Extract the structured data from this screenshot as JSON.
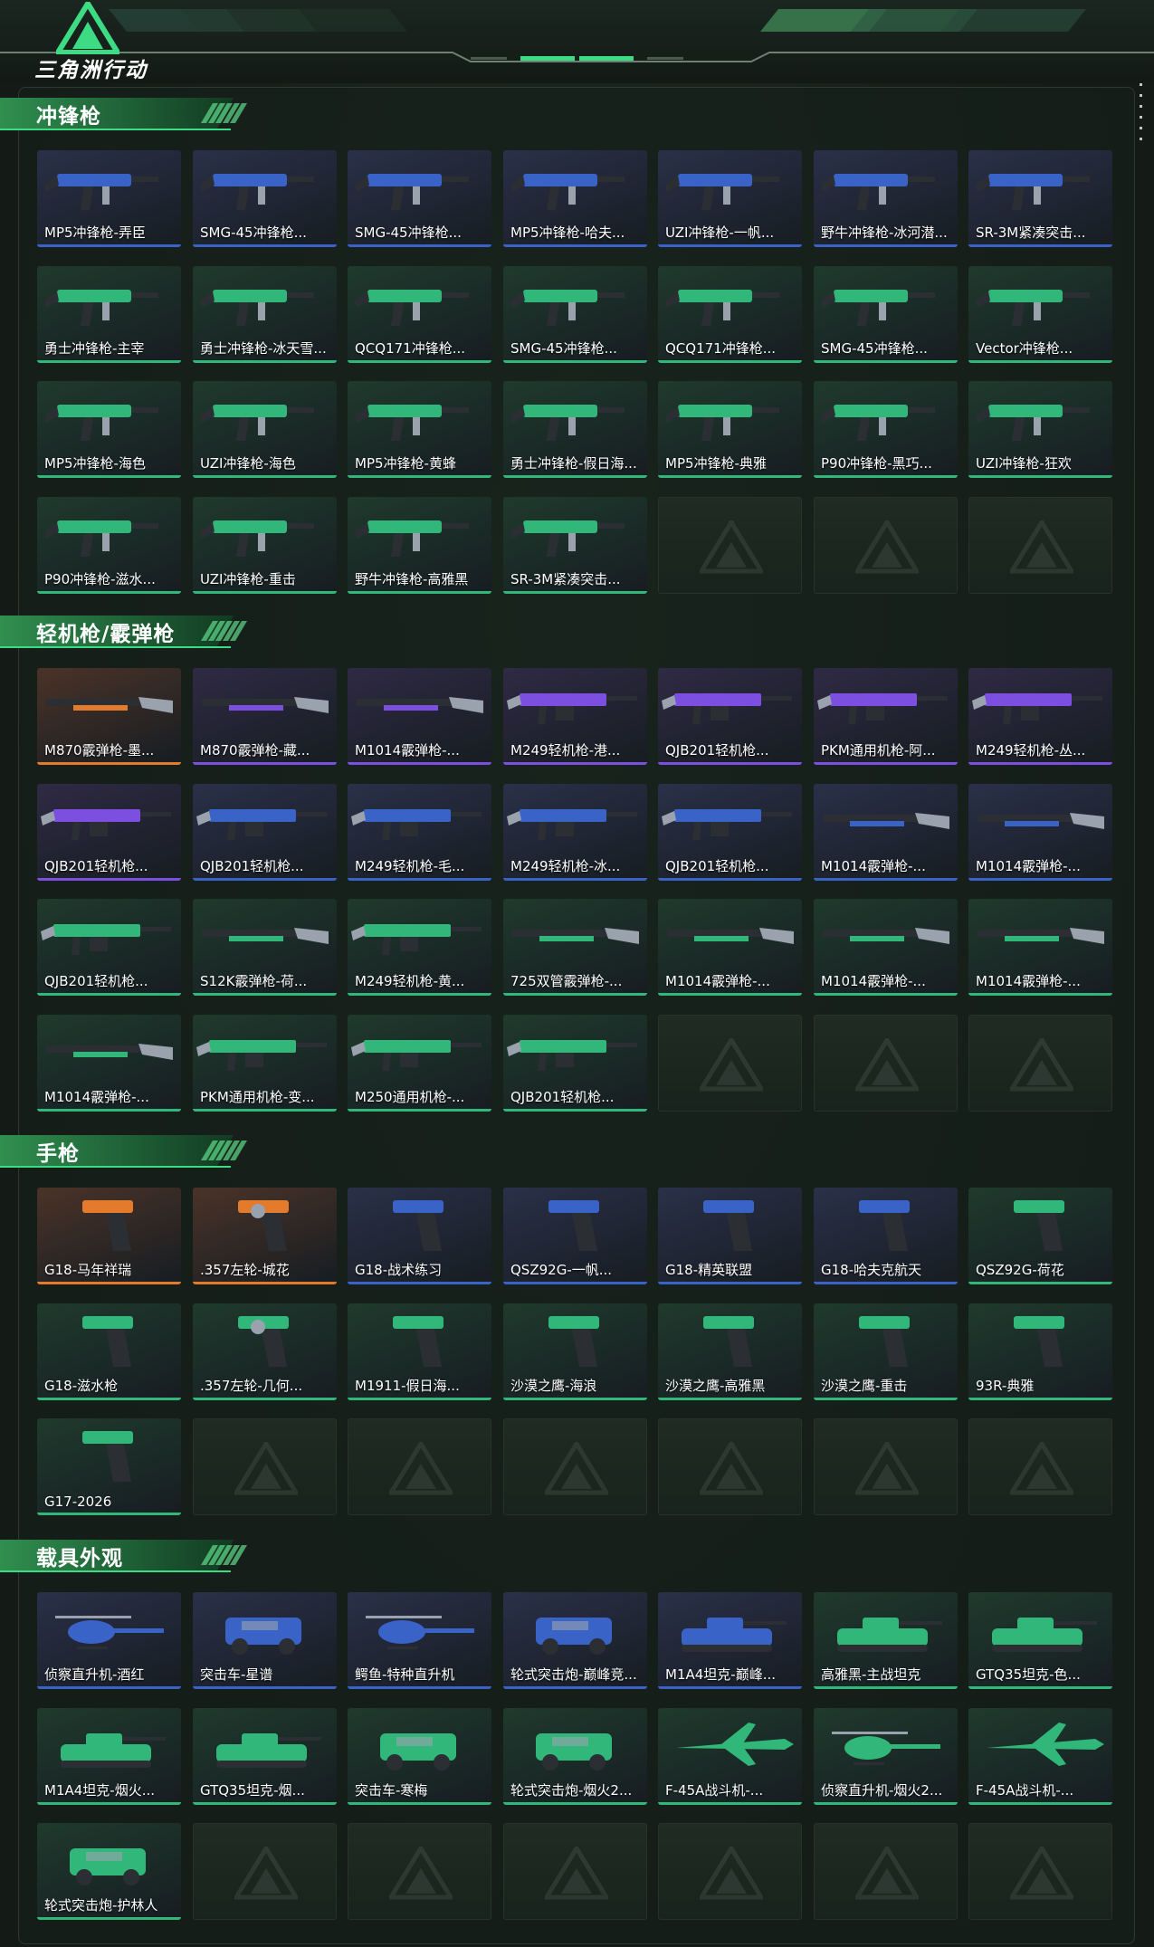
{
  "header": {
    "logo_text": "三角洲行动"
  },
  "colors": {
    "blue": "#3a63c8",
    "purple": "#7d4fe0",
    "orange": "#e37a2c",
    "green": "#31b779",
    "bg_blue": "#2a3048",
    "bg_purple": "#2f2a44",
    "bg_orange": "#4a3328",
    "bg_green": "#1f3a2d"
  },
  "sections": [
    {
      "title": "冲锋枪",
      "items": [
        {
          "label": "MP5冲锋枪-弄臣",
          "rarity": "blue",
          "icon": "smg-icon"
        },
        {
          "label": "SMG-45冲锋枪...",
          "rarity": "blue",
          "icon": "smg-icon"
        },
        {
          "label": "SMG-45冲锋枪...",
          "rarity": "blue",
          "icon": "smg-icon"
        },
        {
          "label": "MP5冲锋枪-哈夫...",
          "rarity": "blue",
          "icon": "smg-icon"
        },
        {
          "label": "UZI冲锋枪-一帆...",
          "rarity": "blue",
          "icon": "smg-icon"
        },
        {
          "label": "野牛冲锋枪-冰河潜...",
          "rarity": "blue",
          "icon": "smg-icon"
        },
        {
          "label": "SR-3M紧凑突击...",
          "rarity": "blue",
          "icon": "smg-icon"
        },
        {
          "label": "勇士冲锋枪-主宰",
          "rarity": "green",
          "icon": "smg-icon"
        },
        {
          "label": "勇士冲锋枪-冰天雪...",
          "rarity": "green",
          "icon": "smg-icon"
        },
        {
          "label": "QCQ171冲锋枪...",
          "rarity": "green",
          "icon": "smg-icon"
        },
        {
          "label": "SMG-45冲锋枪...",
          "rarity": "green",
          "icon": "smg-icon"
        },
        {
          "label": "QCQ171冲锋枪...",
          "rarity": "green",
          "icon": "smg-icon"
        },
        {
          "label": "SMG-45冲锋枪...",
          "rarity": "green",
          "icon": "smg-icon"
        },
        {
          "label": "Vector冲锋枪...",
          "rarity": "green",
          "icon": "smg-icon"
        },
        {
          "label": "MP5冲锋枪-海色",
          "rarity": "green",
          "icon": "smg-icon"
        },
        {
          "label": "UZI冲锋枪-海色",
          "rarity": "green",
          "icon": "smg-icon"
        },
        {
          "label": "MP5冲锋枪-黄蜂",
          "rarity": "green",
          "icon": "smg-icon"
        },
        {
          "label": "勇士冲锋枪-假日海...",
          "rarity": "green",
          "icon": "smg-icon"
        },
        {
          "label": "MP5冲锋枪-典雅",
          "rarity": "green",
          "icon": "smg-icon"
        },
        {
          "label": "P90冲锋枪-黑巧...",
          "rarity": "green",
          "icon": "smg-icon"
        },
        {
          "label": "UZI冲锋枪-狂欢",
          "rarity": "green",
          "icon": "smg-icon"
        },
        {
          "label": "P90冲锋枪-滋水...",
          "rarity": "green",
          "icon": "smg-icon"
        },
        {
          "label": "UZI冲锋枪-重击",
          "rarity": "green",
          "icon": "smg-icon"
        },
        {
          "label": "野牛冲锋枪-高雅黑",
          "rarity": "green",
          "icon": "smg-icon"
        },
        {
          "label": "SR-3M紧凑突击...",
          "rarity": "green",
          "icon": "smg-icon"
        }
      ]
    },
    {
      "title": "轻机枪/霰弹枪",
      "items": [
        {
          "label": "M870霰弹枪-墨...",
          "rarity": "orange",
          "icon": "shotgun-icon"
        },
        {
          "label": "M870霰弹枪-藏...",
          "rarity": "purple",
          "icon": "shotgun-icon"
        },
        {
          "label": "M1014霰弹枪-...",
          "rarity": "purple",
          "icon": "shotgun-icon"
        },
        {
          "label": "M249轻机枪-港...",
          "rarity": "purple",
          "icon": "lmg-icon"
        },
        {
          "label": "QJB201轻机枪...",
          "rarity": "purple",
          "icon": "lmg-icon"
        },
        {
          "label": "PKM通用机枪-阿...",
          "rarity": "purple",
          "icon": "lmg-icon"
        },
        {
          "label": "M249轻机枪-丛...",
          "rarity": "purple",
          "icon": "lmg-icon"
        },
        {
          "label": "QJB201轻机枪...",
          "rarity": "purple",
          "icon": "lmg-icon"
        },
        {
          "label": "QJB201轻机枪...",
          "rarity": "blue",
          "icon": "lmg-icon"
        },
        {
          "label": "M249轻机枪-毛...",
          "rarity": "blue",
          "icon": "lmg-icon"
        },
        {
          "label": "M249轻机枪-冰...",
          "rarity": "blue",
          "icon": "lmg-icon"
        },
        {
          "label": "QJB201轻机枪...",
          "rarity": "blue",
          "icon": "lmg-icon"
        },
        {
          "label": "M1014霰弹枪-...",
          "rarity": "blue",
          "icon": "shotgun-icon"
        },
        {
          "label": "M1014霰弹枪-...",
          "rarity": "blue",
          "icon": "shotgun-icon"
        },
        {
          "label": "QJB201轻机枪...",
          "rarity": "green",
          "icon": "lmg-icon"
        },
        {
          "label": "S12K霰弹枪-荷...",
          "rarity": "green",
          "icon": "shotgun-icon"
        },
        {
          "label": "M249轻机枪-黄...",
          "rarity": "green",
          "icon": "lmg-icon"
        },
        {
          "label": "725双管霰弹枪-...",
          "rarity": "green",
          "icon": "shotgun-icon"
        },
        {
          "label": "M1014霰弹枪-...",
          "rarity": "green",
          "icon": "shotgun-icon"
        },
        {
          "label": "M1014霰弹枪-...",
          "rarity": "green",
          "icon": "shotgun-icon"
        },
        {
          "label": "M1014霰弹枪-...",
          "rarity": "green",
          "icon": "shotgun-icon"
        },
        {
          "label": "M1014霰弹枪-...",
          "rarity": "green",
          "icon": "shotgun-icon"
        },
        {
          "label": "PKM通用机枪-变...",
          "rarity": "green",
          "icon": "lmg-icon"
        },
        {
          "label": "M250通用机枪-...",
          "rarity": "green",
          "icon": "lmg-icon"
        },
        {
          "label": "QJB201轻机枪...",
          "rarity": "green",
          "icon": "lmg-icon"
        }
      ]
    },
    {
      "title": "手枪",
      "items": [
        {
          "label": "G18-马年祥瑞",
          "rarity": "orange",
          "icon": "pistol-icon"
        },
        {
          "label": ".357左轮-城花",
          "rarity": "orange",
          "icon": "revolver-icon"
        },
        {
          "label": "G18-战术练习",
          "rarity": "blue",
          "icon": "pistol-icon"
        },
        {
          "label": "QSZ92G-一帆...",
          "rarity": "blue",
          "icon": "pistol-icon"
        },
        {
          "label": "G18-精英联盟",
          "rarity": "blue",
          "icon": "pistol-icon"
        },
        {
          "label": "G18-哈夫克航天",
          "rarity": "blue",
          "icon": "pistol-icon"
        },
        {
          "label": "QSZ92G-荷花",
          "rarity": "green",
          "icon": "pistol-icon"
        },
        {
          "label": "G18-滋水枪",
          "rarity": "green",
          "icon": "pistol-icon"
        },
        {
          "label": ".357左轮-几何...",
          "rarity": "green",
          "icon": "revolver-icon"
        },
        {
          "label": "M1911-假日海...",
          "rarity": "green",
          "icon": "pistol-icon"
        },
        {
          "label": "沙漠之鹰-海浪",
          "rarity": "green",
          "icon": "pistol-icon"
        },
        {
          "label": "沙漠之鹰-高雅黑",
          "rarity": "green",
          "icon": "pistol-icon"
        },
        {
          "label": "沙漠之鹰-重击",
          "rarity": "green",
          "icon": "pistol-icon"
        },
        {
          "label": "93R-典雅",
          "rarity": "green",
          "icon": "pistol-icon"
        },
        {
          "label": "G17-2026",
          "rarity": "green",
          "icon": "pistol-icon"
        }
      ]
    },
    {
      "title": "载具外观",
      "items": [
        {
          "label": "侦察直升机-酒红",
          "rarity": "blue",
          "icon": "helicopter-icon"
        },
        {
          "label": "突击车-星谱",
          "rarity": "blue",
          "icon": "vehicle-icon"
        },
        {
          "label": "鳄鱼-特种直升机",
          "rarity": "blue",
          "icon": "helicopter-icon"
        },
        {
          "label": "轮式突击炮-巅峰竞...",
          "rarity": "blue",
          "icon": "vehicle-icon"
        },
        {
          "label": "M1A4坦克-巅峰...",
          "rarity": "blue",
          "icon": "tank-icon"
        },
        {
          "label": "高雅黑-主战坦克",
          "rarity": "green",
          "icon": "tank-icon"
        },
        {
          "label": "GTQ35坦克-色...",
          "rarity": "green",
          "icon": "tank-icon"
        },
        {
          "label": "M1A4坦克-烟火...",
          "rarity": "green",
          "icon": "tank-icon"
        },
        {
          "label": "GTQ35坦克-烟...",
          "rarity": "green",
          "icon": "tank-icon"
        },
        {
          "label": "突击车-寒梅",
          "rarity": "green",
          "icon": "vehicle-icon"
        },
        {
          "label": "轮式突击炮-烟火2...",
          "rarity": "green",
          "icon": "vehicle-icon"
        },
        {
          "label": "F-45A战斗机-...",
          "rarity": "green",
          "icon": "jet-icon"
        },
        {
          "label": "侦察直升机-烟火2...",
          "rarity": "green",
          "icon": "helicopter-icon"
        },
        {
          "label": "F-45A战斗机-...",
          "rarity": "green",
          "icon": "jet-icon"
        },
        {
          "label": "轮式突击炮-护林人",
          "rarity": "green",
          "icon": "vehicle-icon"
        }
      ]
    }
  ]
}
